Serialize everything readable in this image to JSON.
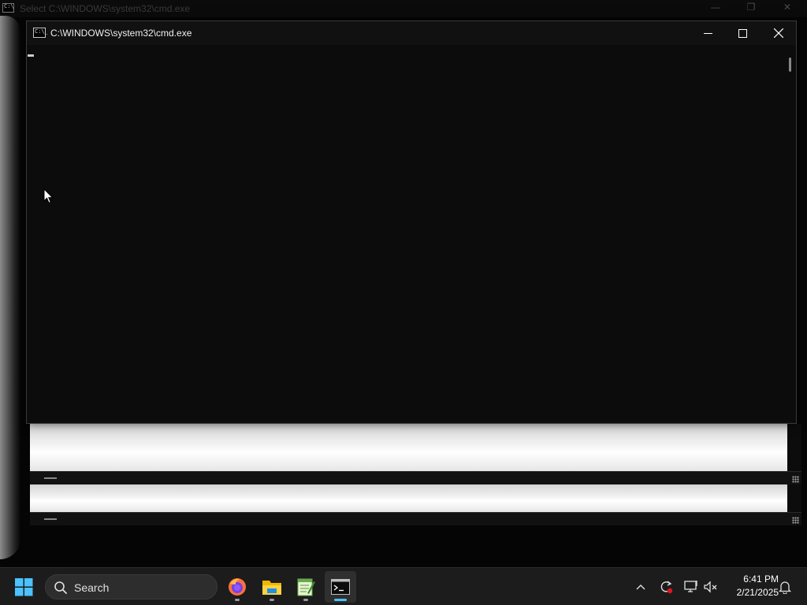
{
  "background_window": {
    "title": "Select C:\\WINDOWS\\system32\\cmd.exe",
    "minimize_label": "—",
    "restore_label": "❐",
    "close_label": "✕"
  },
  "cmd_window": {
    "title": "C:\\WINDOWS\\system32\\cmd.exe",
    "icon_glyph": "C:\\_",
    "console_text": ""
  },
  "taskbar": {
    "search_label": "Search",
    "apps": [
      {
        "name": "firefox",
        "icon": "firefox-icon"
      },
      {
        "name": "file-explorer",
        "icon": "folder-icon"
      },
      {
        "name": "notepad-plus",
        "icon": "notepad-icon"
      },
      {
        "name": "command-prompt",
        "icon": "terminal-icon",
        "active": true
      }
    ],
    "tray": {
      "chevron": "^",
      "time": "6:41 PM",
      "date": "2/21/2025"
    }
  },
  "colors": {
    "accent": "#4cc2ff",
    "console_bg": "#0c0c0c",
    "taskbar_bg": "#1c1c1c"
  }
}
